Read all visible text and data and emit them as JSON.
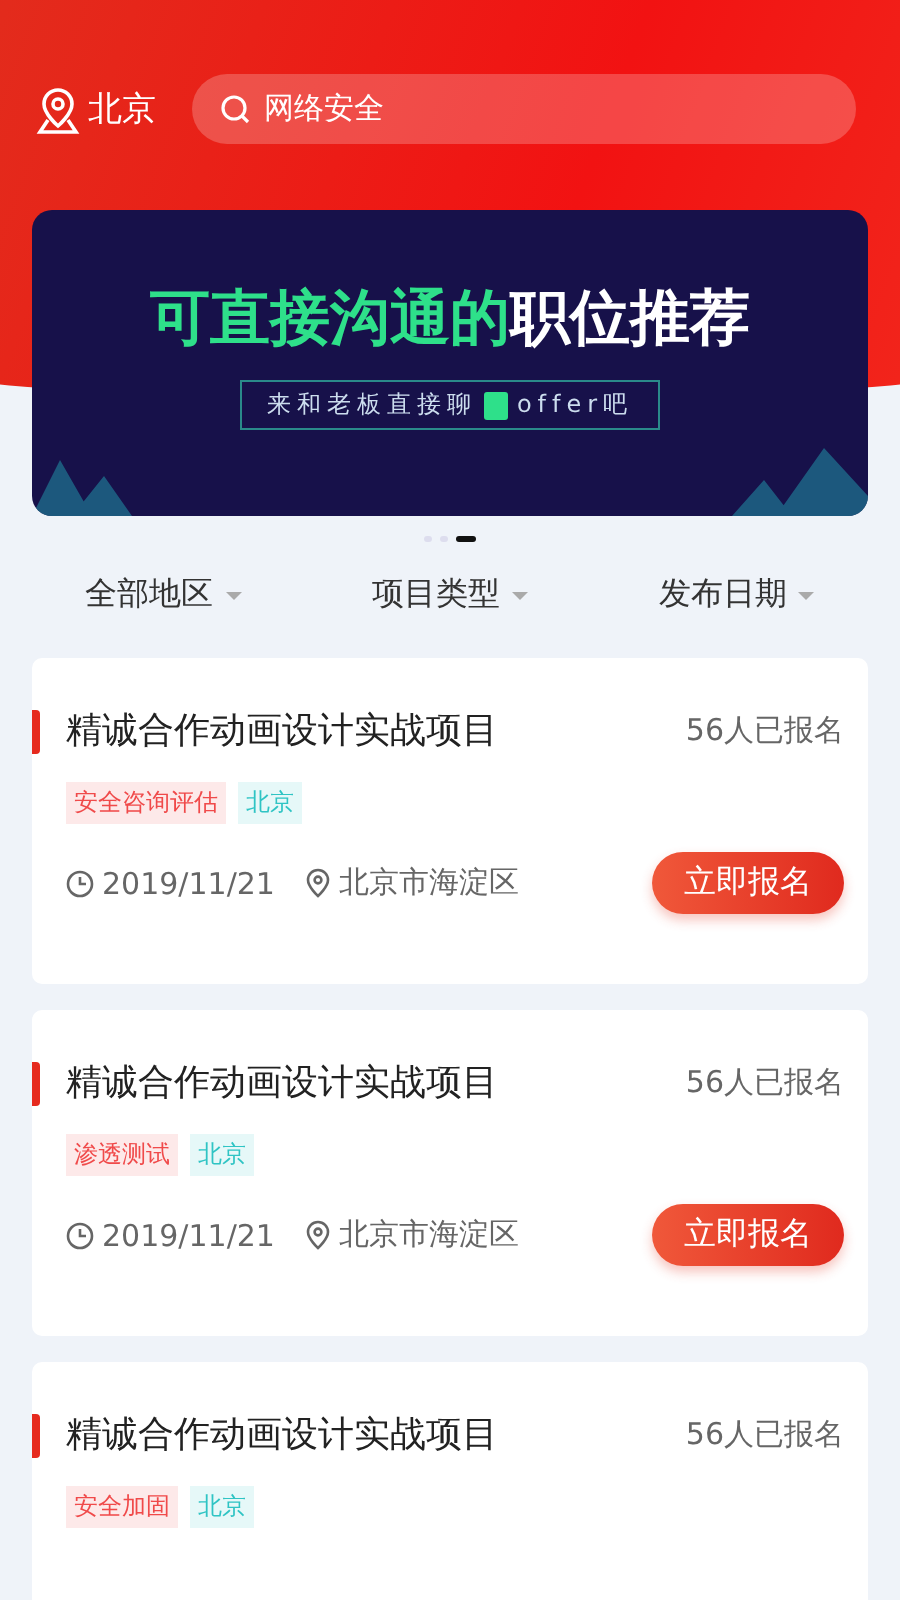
{
  "header": {
    "city": "北京",
    "search": {
      "value": "网络安全"
    }
  },
  "banner": {
    "headline_green": "可直接沟通的",
    "headline_white": "职位推荐",
    "subline": "来和老板直接聊",
    "subline_tail": "offer吧"
  },
  "carousel_dots": [
    {
      "selected": false
    },
    {
      "selected": false
    },
    {
      "selected": true
    }
  ],
  "filters": [
    {
      "label": "全部地区"
    },
    {
      "label": "项目类型"
    },
    {
      "label": "发布日期"
    }
  ],
  "projects": [
    {
      "title": "精诚合作动画设计实战项目",
      "signups": "56人已报名",
      "tags": [
        {
          "label": "安全咨询评估",
          "color": "#f04a4a"
        },
        {
          "label": "北京",
          "color": "#2fc4c4"
        }
      ],
      "date": "2019/11/21",
      "location": "北京市海淀区",
      "button": "立即报名"
    },
    {
      "title": "精诚合作动画设计实战项目",
      "signups": "56人已报名",
      "tags": [
        {
          "label": "渗透测试",
          "color": "#f04a4a"
        },
        {
          "label": "北京",
          "color": "#2fc4c4"
        }
      ],
      "date": "2019/11/21",
      "location": "北京市海淀区",
      "button": "立即报名"
    },
    {
      "title": "精诚合作动画设计实战项目",
      "signups": "56人已报名",
      "tags": [
        {
          "label": "安全加固",
          "color": "#f04a4a"
        },
        {
          "label": "北京",
          "color": "#2fc4c4"
        }
      ]
    }
  ]
}
